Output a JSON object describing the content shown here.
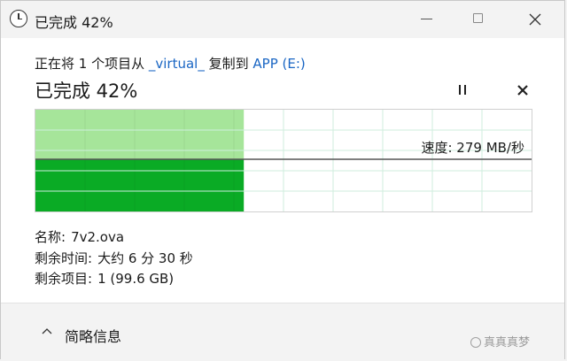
{
  "window": {
    "title": "已完成 42%"
  },
  "copy": {
    "prefix": "正在将 1 个项目从",
    "source": "_virtual_",
    "middle": "复制到",
    "destination": "APP (E:)"
  },
  "status": {
    "big_text": "已完成 42%",
    "progress_percent": 42
  },
  "graph": {
    "speed_text": "速度: 279 MB/秒",
    "fill_color": "#0aab25",
    "past_color": "#a6e59a"
  },
  "details": {
    "name_label": "名称:",
    "name_value": "7v2.ova",
    "time_label": "剩余时间:",
    "time_value": "大约 6 分 30 秒",
    "items_label": "剩余项目:",
    "items_value": "1 (99.6 GB)"
  },
  "footer": {
    "toggle_label": "简略信息",
    "watermark": "真真真梦"
  },
  "icons": {
    "window": "clock-icon",
    "pause": "pause-icon",
    "cancel": "close-icon",
    "toggle": "chevron-up-icon"
  }
}
